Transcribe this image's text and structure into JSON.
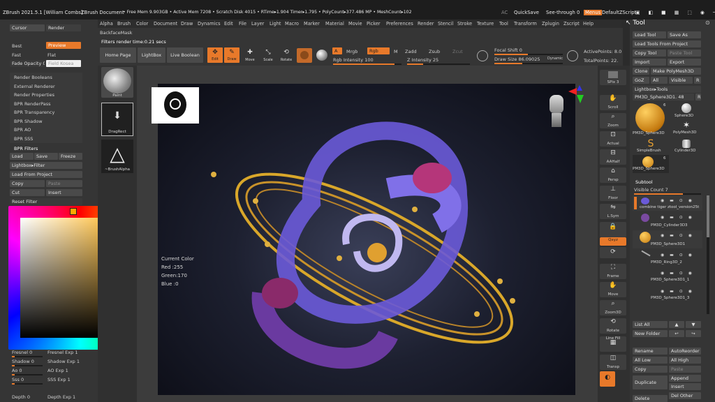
{
  "titlebar": {
    "app": "ZBrush 2021.5.1 [William Combs]",
    "doc": "ZBrush Document",
    "mem": "• Free Mem 9.903GB • Active Mem 7208 • Scratch Disk 4015 • RTime▸1.904 Timer▸1.795 • PolyCount▸377.486 MP • MeshCount▸102",
    "ac": "AC",
    "quicksave": "QuickSave",
    "seethrough": "See-through 0",
    "menus": "Menus",
    "defaultzscript": "DefaultZScript"
  },
  "menubar": {
    "items": [
      "Alpha",
      "Brush",
      "Color",
      "Document",
      "Draw",
      "Dynamics",
      "Edit",
      "File",
      "Layer",
      "Light",
      "Macro",
      "Marker",
      "Material",
      "Movie",
      "Picker",
      "Preferences",
      "Render",
      "Stencil",
      "Stroke",
      "Texture",
      "Tool",
      "Transform",
      "Zplugin",
      "Zscript",
      "Help"
    ]
  },
  "left": {
    "cursor": "Cursor",
    "render": "Render",
    "best": "Best",
    "preview": "Preview",
    "fast": "Fast",
    "flat": "Flat",
    "fade": "Fade Opacity 0",
    "fade_ph": "Field Kosea",
    "sections": [
      "Render Booleans",
      "External Renderer",
      "Render Properties",
      "BPR RenderPass",
      "BPR Transparency",
      "BPR Shadow",
      "BPR AO",
      "BPR SSS",
      "BPR Filters"
    ],
    "load": "Load",
    "save": "Save",
    "freeze": "Freeze",
    "lightbox_filter": "Lightbox▸Filter",
    "load_project": "Load From Project",
    "copy": "Copy",
    "paste": "Paste",
    "cut": "Cut",
    "insert": "Insert",
    "reset_filter": "Reset Filter",
    "bottom": [
      [
        "Fresnel 0",
        "Fresnel Exp 1"
      ],
      [
        "Shadow 0",
        "Shadow Exp 1"
      ],
      [
        "Ao 0",
        "AO Exp 1"
      ],
      [
        "Sss 0",
        "SSS Exp 1"
      ],
      [
        "Depth 0",
        "Depth Exp 1"
      ]
    ]
  },
  "shelf": {
    "backface": "BackfaceMask",
    "filters_time": "Filters render time:0.21 secs",
    "home": "Home Page",
    "lightbox": "LightBox",
    "live_boolean": "Live Boolean",
    "edit": "Edit",
    "draw": "Draw",
    "move": "Move",
    "scale": "Scale",
    "rotate": "Rotate",
    "a": "A",
    "mrgb": "Mrgb",
    "rgb": "Rgb",
    "m": "M",
    "zadd": "Zadd",
    "zsub": "Zsub",
    "zcut": "Zcut",
    "rgb_intensity": "Rgb Intensity 100",
    "z_intensity": "Z Intensity 25",
    "rgb_level": 0.9,
    "z_level": 0.25,
    "focal": "Focal Shift 0",
    "drawsize": "Draw Size 86.09025",
    "dynamic": "Dynamic",
    "activepoints": "ActivePoints: 8.0",
    "totalpoints": "TotalPoints: 22."
  },
  "tray": {
    "paint": "Paint",
    "dragrect": "DragRect",
    "brushalpha": "~BrushAlpha"
  },
  "tooltip": {
    "title": "Current Color",
    "red": "Red :255",
    "green": "Green:170",
    "blue": "Blue :0"
  },
  "colors": {
    "accent": "#e8792a",
    "current": "#ffaa00"
  },
  "righttray": {
    "spix": "SPix 3",
    "scroll": "Scroll",
    "zoom": "Zoom",
    "actual": "Actual",
    "aahalf": "AAHalf",
    "persp": "Persp",
    "floor": "Floor",
    "lsym": "L.Sym",
    "xyz": "Qxyz",
    "frame": "Frame",
    "move": "Move",
    "zoom3d": "Zoom3D",
    "rotate": "Rotate",
    "linefill": "Line Fill",
    "transp": "Transp"
  },
  "tool": {
    "title": "Tool",
    "load": "Load Tool",
    "saveas": "Save As",
    "loadproject": "Load Tools From Project",
    "copytool": "Copy Tool",
    "pastetool": "Paste Tool",
    "import": "Import",
    "export": "Export",
    "clone": "Clone",
    "makepoly": "Make PolyMesh3D",
    "goz": "GoZ",
    "all": "All",
    "visible": "Visible",
    "r": "R",
    "lightboxtools": "Lightbox▸Tools",
    "current": "PM3D_Sphere3D1. 48",
    "thumbs": [
      "PM3D_Sphere3D",
      "Sphere3D",
      "PolyMesh3D",
      "SimpleBrush",
      "Cylinder3D",
      "PM3D_Sphere3D"
    ],
    "count6": "6",
    "count6b": "6",
    "subtool": "Subtool",
    "visiblecount": "Visible Count 7",
    "subtools": [
      "combine tiger ztool_version25t",
      "PM3D_Cylinder3D3",
      "PM3D_Sphere3D1",
      "PM3D_Ring3D_2",
      "PM3D_Sphere3D1_1",
      "PM3D_Sphere3D1_3"
    ],
    "listall": "List All",
    "newfolder": "New Folder",
    "rename": "Rename",
    "autoreorder": "AutoReorder",
    "alllow": "All Low",
    "allhigh": "All High",
    "copy": "Copy",
    "paste": "Paste",
    "duplicate": "Duplicate",
    "append": "Append",
    "insert": "Insert",
    "delete": "Delete",
    "delother": "Del Other"
  }
}
